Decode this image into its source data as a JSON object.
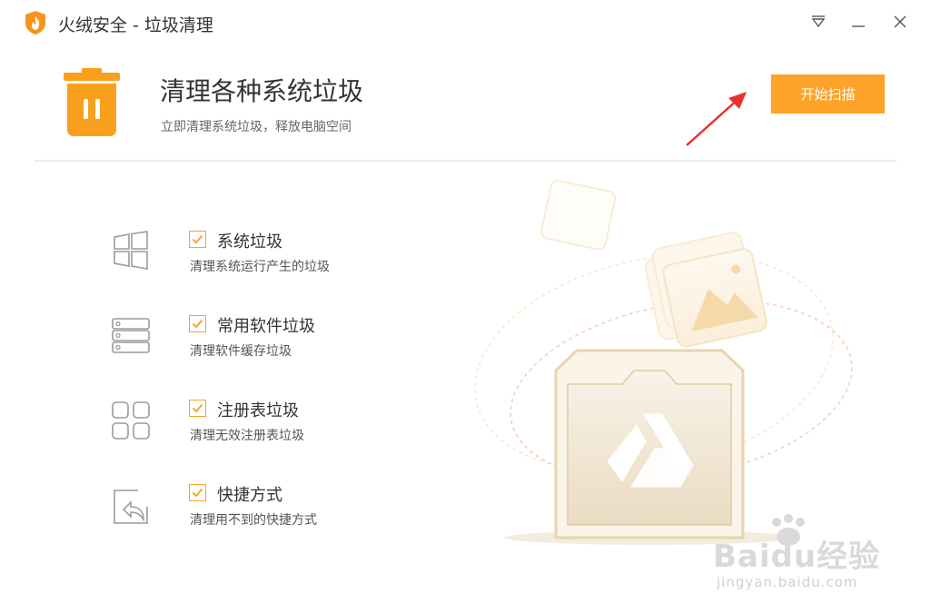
{
  "window": {
    "title": "火绒安全 - 垃圾清理",
    "logo_icon": "flame-shield-icon",
    "menu_icon": "menu-down-triangle-icon",
    "minimize_icon": "minimize-icon",
    "close_icon": "close-icon"
  },
  "header": {
    "icon": "trash-can-icon",
    "title": "清理各种系统垃圾",
    "subtitle": "立即清理系统垃圾，释放电脑空间",
    "scan_button": "开始扫描"
  },
  "items": [
    {
      "label": "系统垃圾",
      "desc": "清理系统运行产生的垃圾",
      "icon": "windows-icon",
      "checked": true
    },
    {
      "label": "常用软件垃圾",
      "desc": "清理软件缓存垃圾",
      "icon": "server-stack-icon",
      "checked": true
    },
    {
      "label": "注册表垃圾",
      "desc": "清理无效注册表垃圾",
      "icon": "registry-grid-icon",
      "checked": true
    },
    {
      "label": "快捷方式",
      "desc": "清理用不到的快捷方式",
      "icon": "shortcut-icon",
      "checked": true
    }
  ],
  "watermark": {
    "main": "Baidu经验",
    "sub": "jingyan.baidu.com"
  },
  "colors": {
    "accent": "#fda32a",
    "checkbox": "#f5a623",
    "arrow": "#e8322e"
  }
}
